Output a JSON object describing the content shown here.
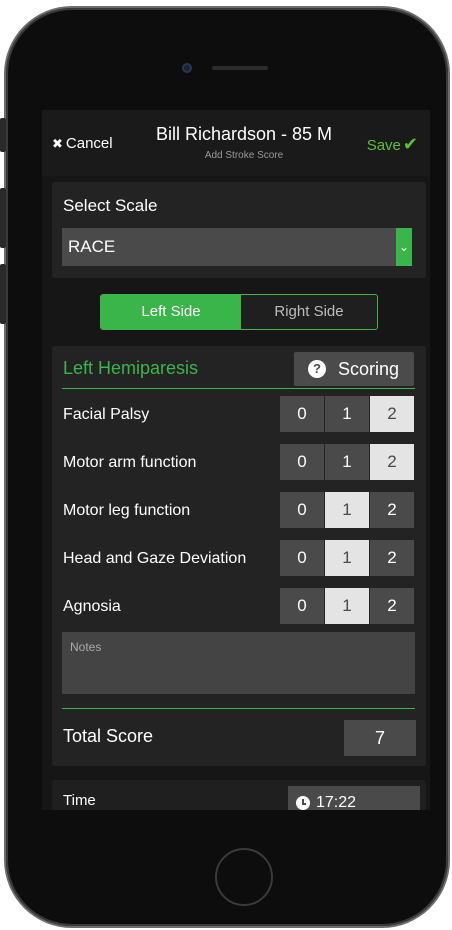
{
  "nav": {
    "cancel_label": "Cancel",
    "title": "Bill Richardson - 85 M",
    "subtitle": "Add Stroke Score",
    "save_label": "Save"
  },
  "scale": {
    "label": "Select Scale",
    "selected": "RACE"
  },
  "side_toggle": {
    "left": "Left Side",
    "right": "Right Side",
    "active": "Left Side"
  },
  "section": {
    "title": "Left Hemiparesis",
    "scoring_label": "Scoring"
  },
  "items": [
    {
      "label": "Facial Palsy",
      "options": [
        "0",
        "1",
        "2"
      ],
      "selected": "2"
    },
    {
      "label": "Motor arm function",
      "options": [
        "0",
        "1",
        "2"
      ],
      "selected": "2"
    },
    {
      "label": "Motor leg function",
      "options": [
        "0",
        "1",
        "2"
      ],
      "selected": "1"
    },
    {
      "label": "Head and Gaze Deviation",
      "options": [
        "0",
        "1",
        "2"
      ],
      "selected": "1"
    },
    {
      "label": "Agnosia",
      "options": [
        "0",
        "1",
        "2"
      ],
      "selected": "1"
    }
  ],
  "notes": {
    "placeholder": "Notes"
  },
  "total": {
    "label": "Total Score",
    "value": "7"
  },
  "time": {
    "label": "Time",
    "value": "17:22"
  },
  "colors": {
    "accent": "#3ab54a",
    "background": "#161616",
    "button": "#4a4a4a",
    "selected": "#e4e4e4"
  }
}
